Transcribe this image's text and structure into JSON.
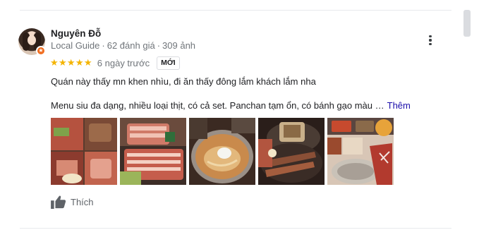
{
  "reviewer": {
    "name": "Nguyên Đỗ",
    "role": "Local Guide",
    "review_count": "62 đánh giá",
    "photo_count": "309 ảnh"
  },
  "review": {
    "stars": "★★★★★",
    "rating_value": 5,
    "time": "6 ngày trước",
    "badge": "MỚI",
    "line1": "Quán này thấy mn khen nhìu, đi ăn thấy đông lắm khách lắm nha",
    "line2": "Menu siu đa dạng, nhiều loại thịt, có cả set. Panchan tạm ổn, có bánh gạo màu …",
    "more_link": "Thêm"
  },
  "photos": [
    {
      "name": "photo-meat-platter-collage"
    },
    {
      "name": "photo-grilled-meat-slices"
    },
    {
      "name": "photo-cold-noodle-soup"
    },
    {
      "name": "photo-grilled-pork-on-grill"
    },
    {
      "name": "photo-side-dishes-table"
    }
  ],
  "actions": {
    "like_label": "Thích"
  },
  "colors": {
    "star": "#f4b400",
    "link": "#1a0dab",
    "guide_badge": "#f06c1e",
    "meta_text": "#70757a"
  },
  "icons": [
    "local-guide-badge-icon",
    "more-vert-icon",
    "thumb-up-icon"
  ]
}
